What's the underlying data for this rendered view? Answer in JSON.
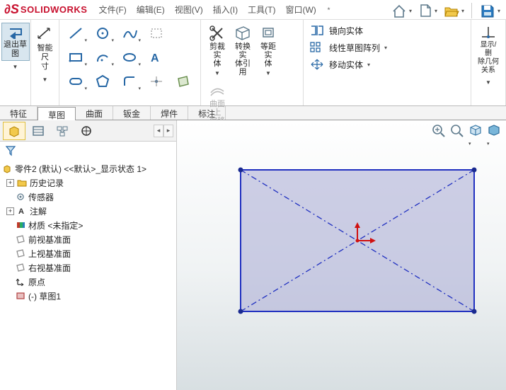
{
  "app": {
    "brand_prefix": "DS",
    "brand_name": "SOLIDWORKS"
  },
  "menu": {
    "file": "文件(F)",
    "edit": "编辑(E)",
    "view": "视图(V)",
    "insert": "插入(I)",
    "tool": "工具(T)",
    "window": "窗口(W)"
  },
  "ribbon": {
    "exit_sketch": "退出草\n图",
    "smart_dim": "智能尺\n寸",
    "trim": "剪裁实\n体",
    "convert": "转换实\n体引用",
    "offset": "等距实\n体",
    "surface_offset": "曲面上\n偏移",
    "mirror": "镜向实体",
    "linear_pattern": "线性草图阵列",
    "move": "移动实体",
    "display_rel": "显示/删\n除几何\n关系"
  },
  "tabs": {
    "feature": "特征",
    "sketch": "草图",
    "surface": "曲面",
    "sheet": "钣金",
    "weld": "焊件",
    "annotate": "标注"
  },
  "tree": {
    "root": "零件2 (默认) <<默认>_显示状态 1>",
    "history": "历史记录",
    "sensors": "传感器",
    "annotations": "注解",
    "material": "材质 <未指定>",
    "front_plane": "前视基准面",
    "top_plane": "上视基准面",
    "right_plane": "右视基准面",
    "origin": "原点",
    "sketch1": "(-) 草图1"
  }
}
